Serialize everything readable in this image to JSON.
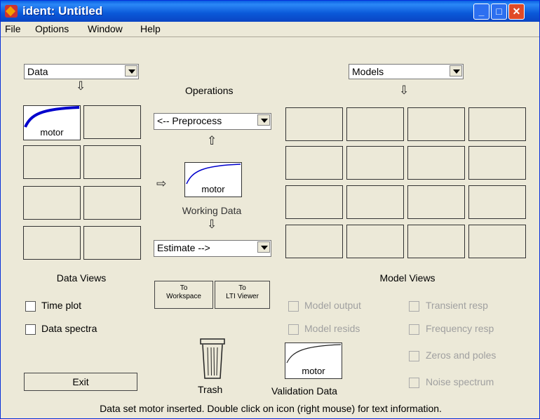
{
  "window": {
    "title": "ident: Untitled"
  },
  "menu": [
    "File",
    "Options",
    "Window",
    "Help"
  ],
  "data_select": "Data",
  "models_select": "Models",
  "operations_label": "Operations",
  "preprocess_select": "<-- Preprocess",
  "estimate_select": "Estimate -->",
  "data_icon_name": "motor",
  "working_data": {
    "name": "motor",
    "label": "Working Data"
  },
  "data_views": {
    "title": "Data Views",
    "checkboxes": [
      "Time plot",
      "Data spectra"
    ]
  },
  "buttons": {
    "to_workspace": [
      "To",
      "Workspace"
    ],
    "to_lti": [
      "To",
      "LTI Viewer"
    ],
    "exit": "Exit"
  },
  "trash_label": "Trash",
  "validation_data": {
    "name": "motor",
    "label": "Validation Data"
  },
  "model_views": {
    "title": "Model Views",
    "left": [
      "Model output",
      "Model resids"
    ],
    "right": [
      "Transient resp",
      "Frequency resp",
      "Zeros and poles",
      "Noise spectrum"
    ]
  },
  "status": "Data set motor inserted.  Double click on icon (right mouse) for text information.",
  "colors": {
    "titlebar": "#0a58d8",
    "curve": "#0000cc"
  }
}
